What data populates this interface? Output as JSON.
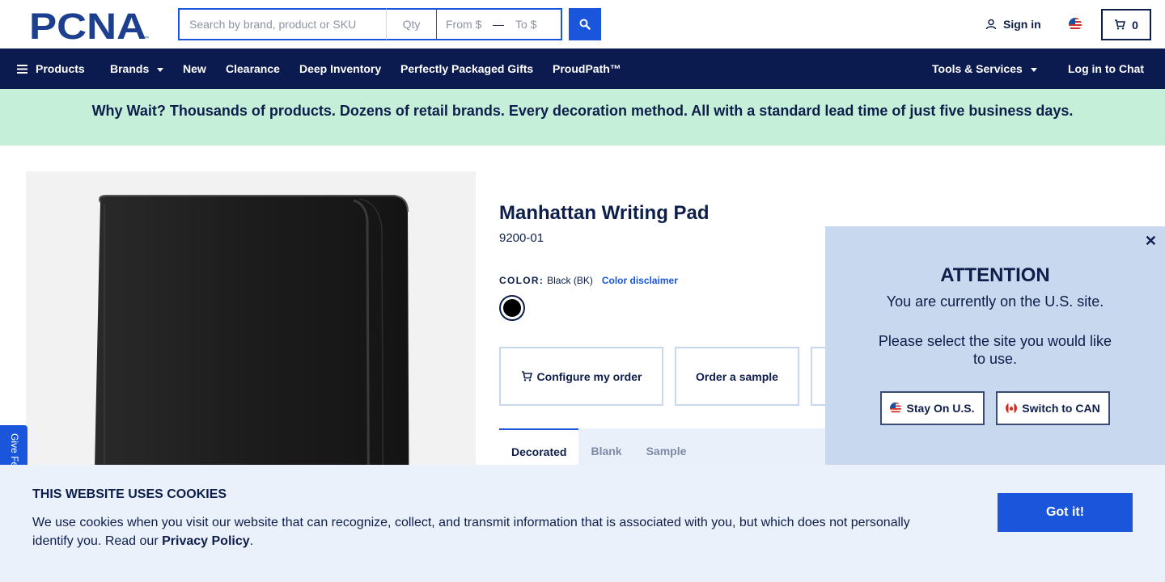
{
  "header": {
    "logo_text": "PCNA",
    "search": {
      "placeholder": "Search by brand, product or SKU",
      "qty_placeholder": "Qty",
      "from_placeholder": "From $",
      "to_placeholder": "To $",
      "separator": "—"
    },
    "sign_in_label": "Sign in",
    "cart_count": "0"
  },
  "nav": {
    "products_label": "Products",
    "items": [
      {
        "label": "Brands"
      },
      {
        "label": "New"
      },
      {
        "label": "Clearance"
      },
      {
        "label": "Deep Inventory"
      },
      {
        "label": "Perfectly Packaged Gifts"
      },
      {
        "label": "ProudPath™"
      }
    ],
    "tools_label": "Tools & Services",
    "chat_label": "Log in to Chat"
  },
  "banner": {
    "text": "Why Wait? Thousands of products. Dozens of retail brands. Every decoration method. All with a standard lead time of just five business days."
  },
  "product": {
    "title": "Manhattan Writing Pad",
    "sku": "9200-01",
    "color_label": "COLOR:",
    "color_value": "Black (BK)",
    "color_disclaimer": "Color disclaimer",
    "swatch_color": "#000000",
    "actions": {
      "configure": "Configure my order",
      "sample": "Order a sample"
    },
    "tabs": [
      {
        "label": "Decorated"
      },
      {
        "label": "Blank"
      },
      {
        "label": "Sample"
      }
    ]
  },
  "feedback": {
    "label": "Give Feedback"
  },
  "site_modal": {
    "title": "ATTENTION",
    "line1": "You are currently on the U.S. site.",
    "line2": "Please select the site you would like to use.",
    "stay_label": "Stay On U.S.",
    "switch_label": "Switch to CAN"
  },
  "cookie": {
    "title": "THIS WEBSITE USES COOKIES",
    "text": "We use cookies when you visit our website that can recognize, collect, and transmit information that is associated with you, but which does not personally identify you. Read our",
    "link": "Privacy Policy",
    "end": ".",
    "button": "Got it!"
  },
  "colors": {
    "navy": "#0b1a4f",
    "accent": "#1a56db",
    "banner": "#c6efd9",
    "modal": "#c8d8ee",
    "cookie_bg": "#eaf1fb"
  }
}
